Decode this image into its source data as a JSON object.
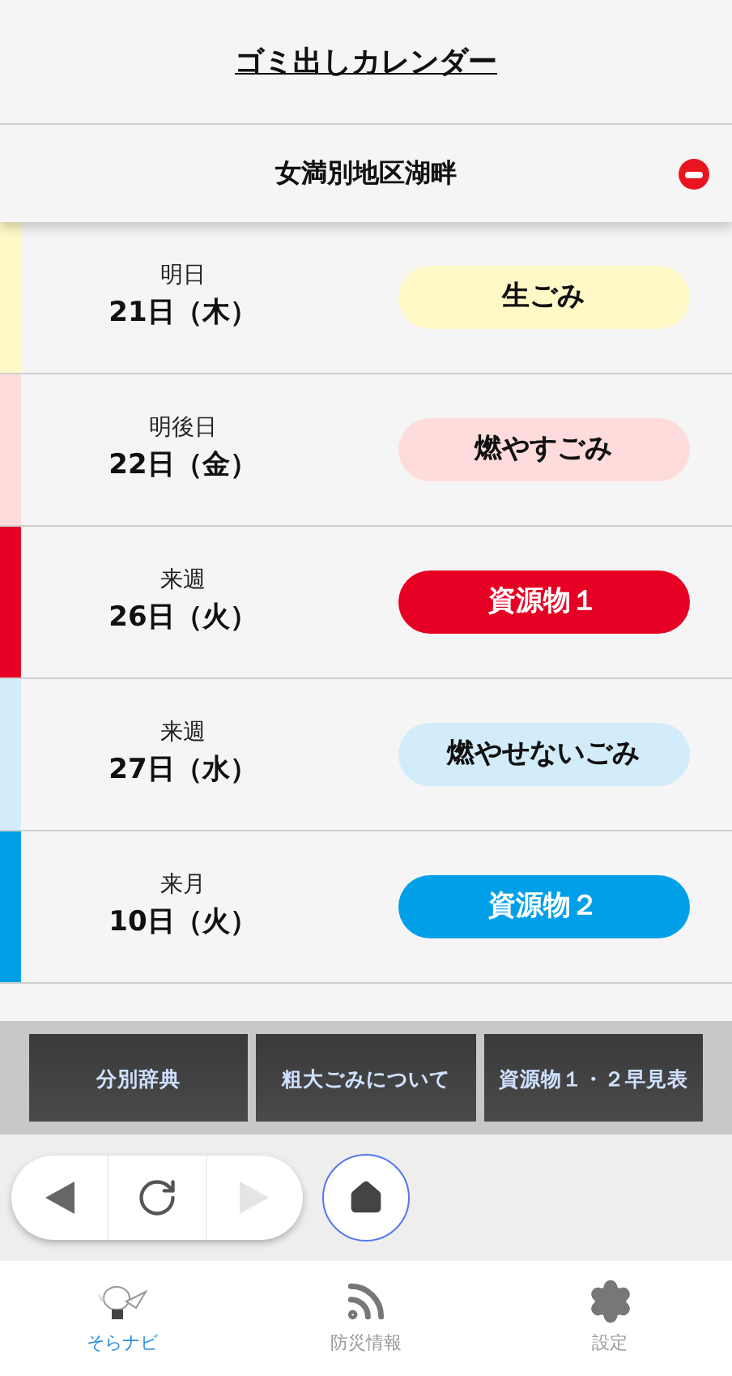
{
  "header": {
    "title": "ゴミ出しカレンダー"
  },
  "area": {
    "name": "女満別地区湖畔"
  },
  "schedule": [
    {
      "relative": "明日",
      "date": "21日（木）",
      "type": "生ごみ",
      "color": "#fff9c8"
    },
    {
      "relative": "明後日",
      "date": "22日（金）",
      "type": "燃やすごみ",
      "color": "#ffdcdc"
    },
    {
      "relative": "来週",
      "date": "26日（火）",
      "type": "資源物１",
      "color": "#e60023"
    },
    {
      "relative": "来週",
      "date": "27日（水）",
      "type": "燃やせないごみ",
      "color": "#d2ecfa"
    },
    {
      "relative": "来月",
      "date": "10日（火）",
      "type": "資源物２",
      "color": "#00a0e9"
    }
  ],
  "links": [
    "分別辞典",
    "粗大ごみについて",
    "資源物１・２早見表"
  ],
  "browser_nav": {
    "back_disabled": false,
    "forward_disabled": true
  },
  "tabs": [
    {
      "label": "そらナビ",
      "kind": "mascot",
      "selected": true
    },
    {
      "label": "防災情報",
      "kind": "feed",
      "selected": false
    },
    {
      "label": "設定",
      "kind": "gear",
      "selected": false
    }
  ]
}
